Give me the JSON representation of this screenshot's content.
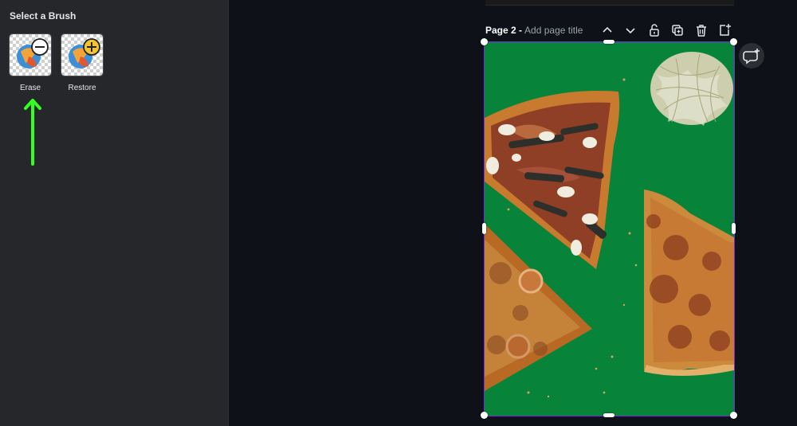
{
  "sidebar": {
    "title": "Select a Brush",
    "brushes": [
      {
        "label": "Erase",
        "icon": "minus-circle-icon"
      },
      {
        "label": "Restore",
        "icon": "plus-circle-icon"
      }
    ]
  },
  "page_header": {
    "page_label": "Page 2 -",
    "title_placeholder": "Add page title",
    "icons": [
      "chevron-up-icon",
      "chevron-down-icon",
      "lock-icon",
      "duplicate-icon",
      "trash-icon",
      "add-page-icon"
    ]
  },
  "colors": {
    "canvas_background": "#07843a",
    "selection": "#7d2ae8",
    "hint_arrow": "#33ff22"
  }
}
